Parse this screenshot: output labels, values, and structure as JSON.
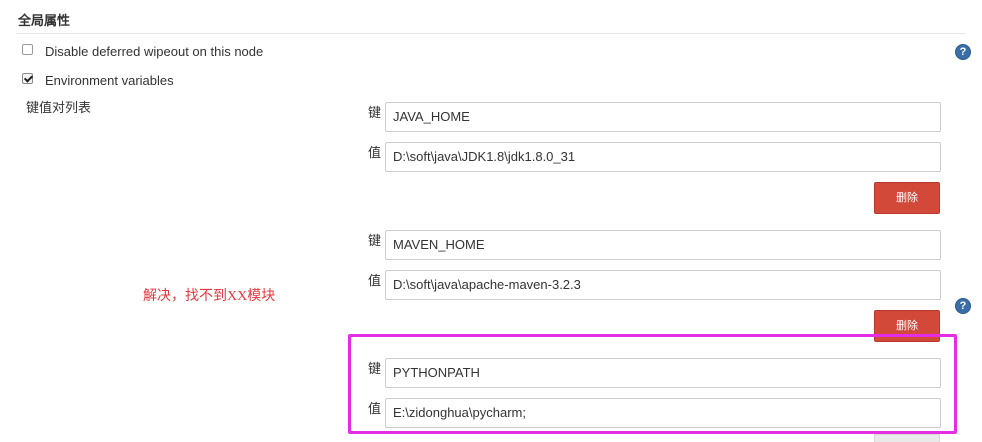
{
  "section": {
    "title": "全局属性"
  },
  "options": [
    {
      "label": "Disable deferred wipeout on this node",
      "checked": false
    },
    {
      "label": "Environment variables",
      "checked": true
    }
  ],
  "kv_list": {
    "title": "键值对列表",
    "key_label": "键",
    "value_label": "值",
    "delete_label": "删除",
    "entries": [
      {
        "key": "JAVA_HOME",
        "value": "D:\\soft\\java\\JDK1.8\\jdk1.8.0_31"
      },
      {
        "key": "MAVEN_HOME",
        "value": "D:\\soft\\java\\apache-maven-3.2.3"
      },
      {
        "key": "PYTHONPATH",
        "value": "E:\\zidonghua\\pycharm;"
      }
    ]
  },
  "help_icon_glyph": "?",
  "annotation": {
    "text": "解决，找不到XX模块",
    "color": "#e8383d",
    "box_color": "#e62de6"
  },
  "colors": {
    "delete_button": "#d24939",
    "help_icon": "#3a6ea8"
  },
  "icons": [
    "help-icon",
    "checkbox-icon"
  ]
}
